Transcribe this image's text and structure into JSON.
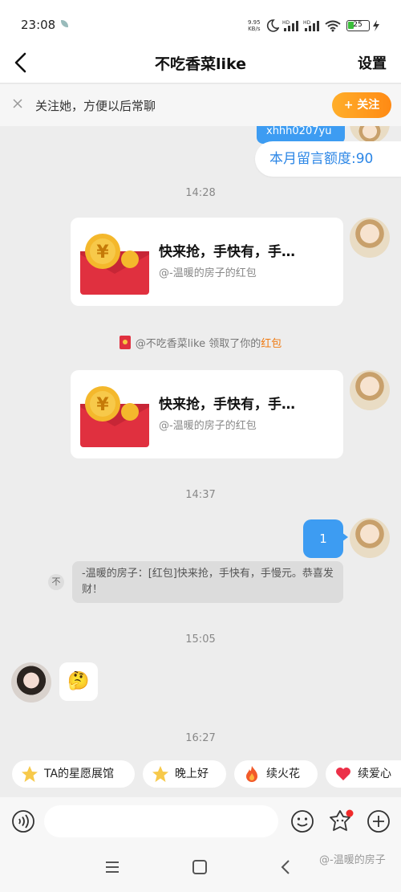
{
  "status_bar": {
    "time": "23:08",
    "net_speed_value": "9.95",
    "net_speed_unit": "KB/s",
    "battery_level": "25",
    "icons": [
      "leaf-icon",
      "moon-icon",
      "signal-hd-icon",
      "signal-hd-icon",
      "wifi-icon",
      "battery-icon",
      "charging-icon"
    ]
  },
  "header": {
    "back_icon": "chevron-left-icon",
    "title": "不吃香菜like",
    "settings_label": "设置"
  },
  "follow_banner": {
    "text": "关注她，方便以后常聊",
    "button_label": "+ 关注"
  },
  "chat": {
    "partial_bubble_text": "xhhh0207yu",
    "quota_text": "本月留言额度:90",
    "timestamp_1": "14:28",
    "red_packet_1": {
      "title": "快来抢，手快有，手…",
      "subtitle": "@-温暖的房子的红包"
    },
    "system_note": {
      "prefix": "@不吃香菜like 领取了你的",
      "highlight": "红包"
    },
    "red_packet_2": {
      "title": "快来抢，手快有，手…",
      "subtitle": "@-温暖的房子的红包"
    },
    "timestamp_2": "14:37",
    "my_message": "1",
    "quote_icon_text": "不",
    "quote_text": "-温暖的房子：[红包]快来抢，手快有，手慢元。恭喜发财！",
    "timestamp_3": "15:05",
    "emoji_message": "🤔",
    "timestamp_4": "16:27"
  },
  "quick_chips": [
    {
      "label": "TA的星愿展馆",
      "icon": "star-icon"
    },
    {
      "label": "晚上好",
      "icon": "star-icon"
    },
    {
      "label": "续火花",
      "icon": "fire-icon"
    },
    {
      "label": "续爱心",
      "icon": "heart-icon"
    }
  ],
  "input_bar": {
    "voice_icon": "voice-icon",
    "placeholder": "",
    "emoji_icon": "smiley-icon",
    "sticker_icon": "sticker-icon",
    "plus_icon": "plus-icon"
  },
  "system_nav": {
    "menu_icon": "menu-icon",
    "home_icon": "home-icon",
    "back_icon": "back-icon"
  },
  "watermark": "@-温暖的房子",
  "colors": {
    "accent_blue": "#3d9cf2",
    "follow_orange": "#ff9a1f",
    "red_packet": "#e0303f",
    "background": "#ededed"
  }
}
